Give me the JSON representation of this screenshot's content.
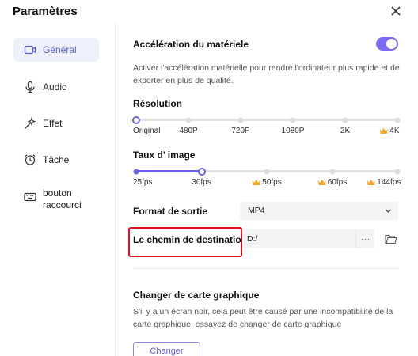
{
  "window": {
    "title": "Paramètres"
  },
  "sidebar": {
    "items": [
      {
        "label": "Général",
        "icon": "video-camera-icon",
        "active": true
      },
      {
        "label": "Audio",
        "icon": "microphone-icon",
        "active": false
      },
      {
        "label": "Effet",
        "icon": "sparkle-icon",
        "active": false
      },
      {
        "label": "Tâche",
        "icon": "alarm-clock-icon",
        "active": false
      },
      {
        "label": "bouton raccourci",
        "icon": "keyboard-icon",
        "active": false
      }
    ]
  },
  "hardware": {
    "title": "Accélération du matériele",
    "enabled": true,
    "description": "Activer l'accélération matérielle pour rendre l'ordinateur plus rapide et de exporter en plus de qualité."
  },
  "resolution": {
    "title": "Résolution",
    "selected_index": 0,
    "options": [
      {
        "label": "Original",
        "premium": false
      },
      {
        "label": "480P",
        "premium": false
      },
      {
        "label": "720P",
        "premium": false
      },
      {
        "label": "1080P",
        "premium": false
      },
      {
        "label": "2K",
        "premium": false
      },
      {
        "label": "4K",
        "premium": true
      }
    ]
  },
  "framerate": {
    "title": "Taux d’ image",
    "selected_index": 1,
    "options": [
      {
        "label": "25fps",
        "premium": false
      },
      {
        "label": "30fps",
        "premium": false
      },
      {
        "label": "50fps",
        "premium": true
      },
      {
        "label": "60fps",
        "premium": true
      },
      {
        "label": "144fps",
        "premium": true
      }
    ]
  },
  "output_format": {
    "title": "Format de sortie",
    "value": "MP4"
  },
  "destination": {
    "title": "Le chemin de destination",
    "value": "D:/",
    "browse_label": "···"
  },
  "graphics": {
    "title": "Changer de carte graphique",
    "description": "S'il y a un écran noir, cela peut être causé par une incompatibilité de la carte graphique, essayez de changer de carte graphique",
    "button_label": "Changer"
  },
  "colors": {
    "accent": "#6c63e6",
    "highlight": "#e0131f",
    "premium": "#f5a623"
  }
}
